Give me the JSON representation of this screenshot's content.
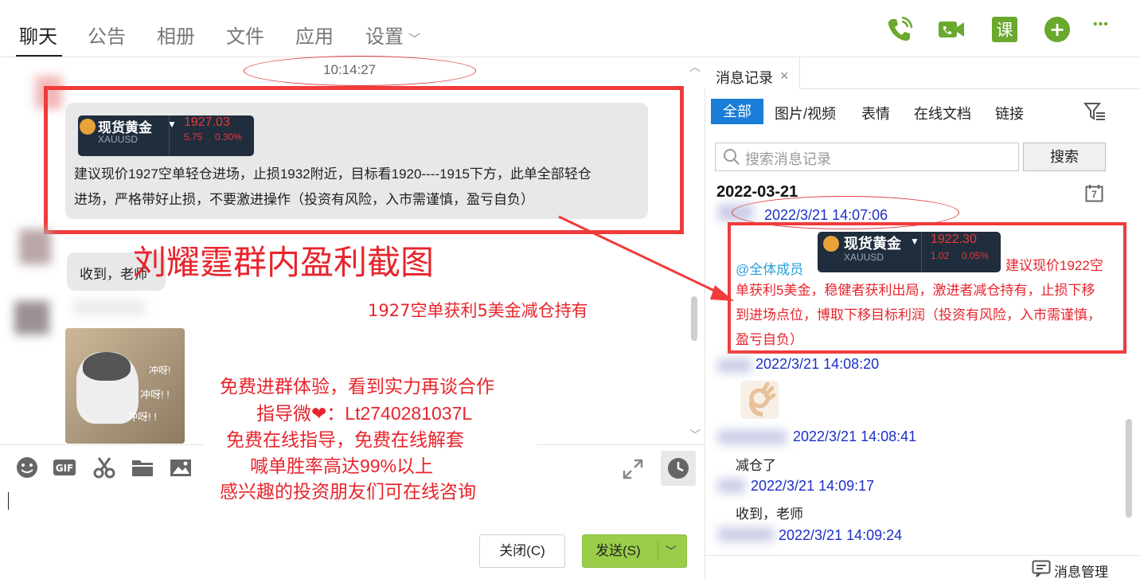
{
  "tabs": [
    "聊天",
    "公告",
    "相册",
    "文件",
    "应用",
    "设置"
  ],
  "top_icons": [
    "phone-icon",
    "video-icon",
    "lesson-icon",
    "add-icon",
    "more-icon"
  ],
  "top_icon_glyphs": {
    "lesson": "课",
    "add": "+",
    "more": "•••"
  },
  "chat": {
    "time_top": "10:14:27",
    "card1": {
      "name": "现货黄金",
      "symbol": "XAUUSD",
      "price": "1927.03",
      "change": "5.75",
      "pct": "0.30%"
    },
    "message1": [
      "建议现价1927空单轻仓进场，止损1932附近，目标看1920----1915下方，此单全部轻仓",
      "进场，严格带好止损，不要激进操作（投资有风险，入市需谨慎，盈亏自负）"
    ],
    "reply1": "收到，老师",
    "caption_big": "刘耀霆群内盈利截图",
    "caption_small": "1927空单获利5美金减仓持有",
    "sticker_text": [
      "冲呀!",
      "冲呀! !",
      "冲呀! !"
    ],
    "promo": [
      "免费进群体验，看到实力再谈合作",
      "指导微❤：Lt2740281037L",
      "免费在线指导，免费在线解套",
      "喊单胜率高达99%以上",
      "感兴趣的投资朋友们可在线咨询"
    ],
    "close_label": "关闭(C)",
    "send_label": "发送(S)",
    "input_text": ""
  },
  "panel": {
    "title": "消息记录",
    "close_glyph": "×",
    "filters": [
      "全部",
      "图片/视频",
      "表情",
      "在线文档",
      "链接"
    ],
    "search_placeholder": "搜索消息记录",
    "search_button": "搜索",
    "date": "2022-03-21",
    "calendar_day": "7",
    "entries": [
      {
        "time": "2022/3/21 14:07:06"
      },
      {
        "time": "2022/3/21 14:08:20"
      },
      {
        "time": "2022/3/21 14:08:41",
        "text": "减仓了"
      },
      {
        "time": "2022/3/21 14:09:17",
        "text": "收到，老师"
      },
      {
        "time": "2022/3/21 14:09:24"
      }
    ],
    "card2": {
      "name": "现货黄金",
      "symbol": "XAUUSD",
      "price": "1922.30",
      "change": "1.02",
      "pct": "0.05%"
    },
    "mention": "@全体成员",
    "message2": [
      "建议现价1922空",
      "单获利5美金，稳健者获利出局，激进者减仓持有，止损下移",
      "到进场点位，博取下移目标利润（投资有风险，入市需谨慎，",
      "盈亏自负）"
    ],
    "manage": "消息管理"
  },
  "colors": {
    "accent_green": "#9acd4a",
    "accent_blue": "#1a7ed8",
    "alert_red": "#f03b3b",
    "stamp_blue": "#1c2fc7"
  }
}
